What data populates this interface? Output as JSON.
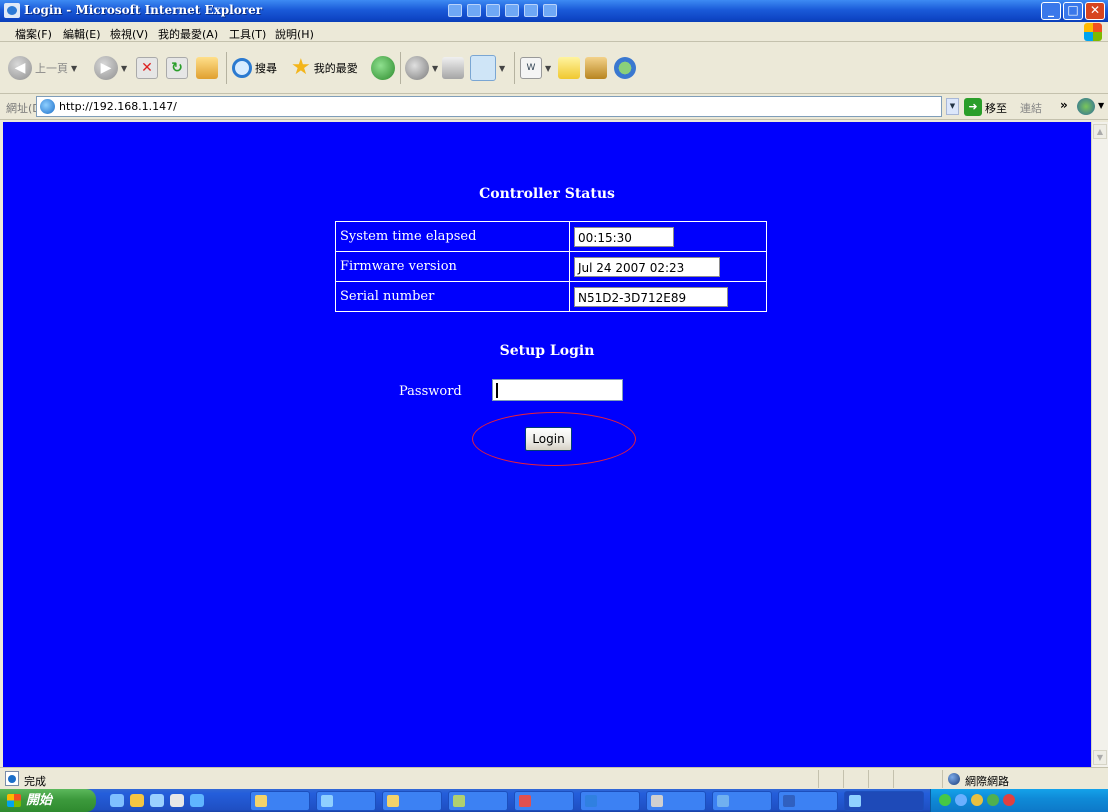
{
  "window": {
    "title": "Login - Microsoft Internet Explorer"
  },
  "menu": {
    "items": [
      "檔案(F)",
      "編輯(E)",
      "檢視(V)",
      "我的最愛(A)",
      "工具(T)",
      "說明(H)"
    ]
  },
  "toolbar": {
    "back_label": "上一頁",
    "search_label": "搜尋",
    "favorites_label": "我的最愛"
  },
  "address": {
    "label": "網址(D)",
    "url": "http://192.168.1.147/",
    "go_label": "移至",
    "links_label": "連結"
  },
  "page": {
    "status_heading": "Controller Status",
    "status_rows": [
      {
        "label": "System time elapsed",
        "value": "00:15:30"
      },
      {
        "label": "Firmware version",
        "value": "Jul 24 2007 02:23"
      },
      {
        "label": "Serial number",
        "value": "N51D2-3D712E89"
      }
    ],
    "login_heading": "Setup Login",
    "password_label": "Password",
    "password_value": "",
    "login_button": "Login"
  },
  "statusbar": {
    "status": "完成",
    "zone": "網際網路"
  },
  "taskbar": {
    "start_label": "開始"
  },
  "colors": {
    "page_background": "#0000fd",
    "annotation_ellipse": "#e8203a"
  }
}
